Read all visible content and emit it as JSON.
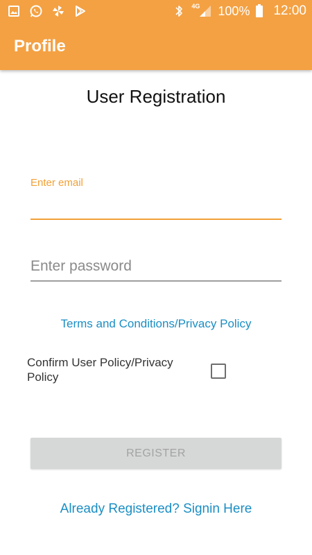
{
  "status_bar": {
    "left_icons": [
      "gallery-icon",
      "whatsapp-icon",
      "pinwheel-icon",
      "play-store-icon"
    ],
    "right_icons": [
      "bluetooth-icon",
      "signal-icon",
      "battery-icon"
    ],
    "network_label": "4G",
    "battery_percent": "100%",
    "time": "12:00"
  },
  "app_bar": {
    "title": "Profile",
    "color": "#f4a143"
  },
  "form": {
    "heading": "User Registration",
    "email": {
      "label": "Enter email",
      "value": ""
    },
    "password": {
      "placeholder": "Enter password",
      "value": ""
    },
    "terms_link": "Terms and Conditions/Privacy Policy",
    "confirm_label": "Confirm User Policy/Privacy Policy",
    "confirm_checked": false,
    "register_label": "REGISTER",
    "signin_link": "Already Registered? Signin Here"
  },
  "colors": {
    "accent": "#f1a036",
    "link": "#1a8ec4",
    "disabled_button": "#d6d7d7"
  }
}
